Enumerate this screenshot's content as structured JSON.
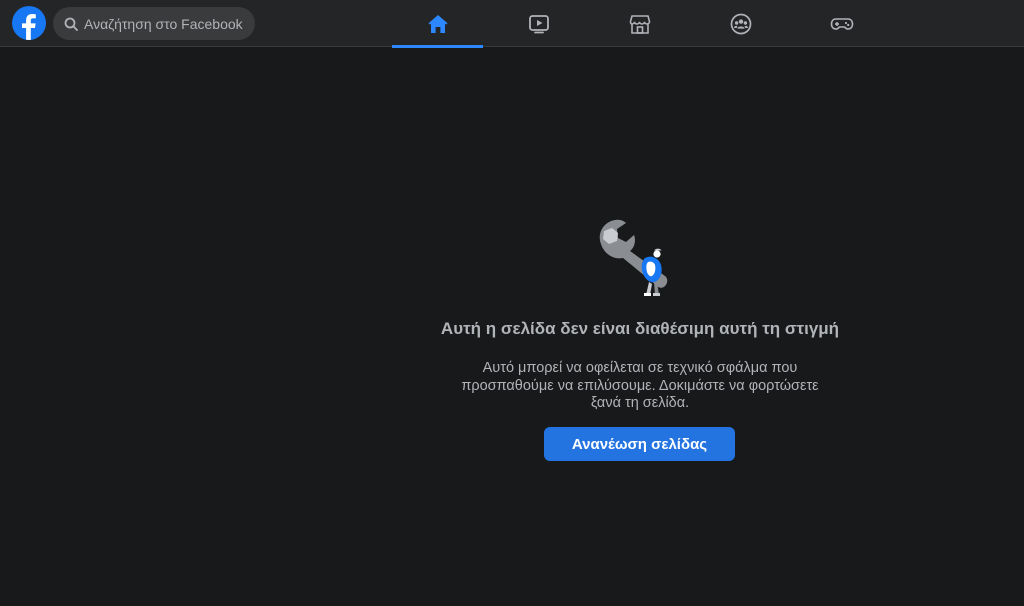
{
  "app": {
    "name": "Facebook",
    "logo_icon": "facebook-logo-icon"
  },
  "colors": {
    "brand": "#1877f2",
    "background": "#18191a",
    "topbar": "#242526",
    "button": "#2374e1",
    "active_tab": "#2d88ff"
  },
  "search": {
    "placeholder": "Αναζήτηση στο Facebook",
    "icon": "search-icon"
  },
  "nav": {
    "tabs": [
      {
        "name": "home",
        "icon": "home-icon",
        "active": true
      },
      {
        "name": "watch",
        "icon": "watch-icon",
        "active": false
      },
      {
        "name": "marketplace",
        "icon": "marketplace-icon",
        "active": false
      },
      {
        "name": "groups",
        "icon": "groups-icon",
        "active": false
      },
      {
        "name": "gaming",
        "icon": "gaming-icon",
        "active": false
      }
    ]
  },
  "error": {
    "illustration": "wrench-person-illustration",
    "title": "Αυτή η σελίδα δεν είναι διαθέσιμη αυτή τη στιγμή",
    "description": "Αυτό μπορεί να οφείλεται σε τεχνικό σφάλμα που προσπαθούμε να επιλύσουμε. Δοκιμάστε να φορτώσετε ξανά τη σελίδα.",
    "button_label": "Ανανέωση σελίδας"
  }
}
